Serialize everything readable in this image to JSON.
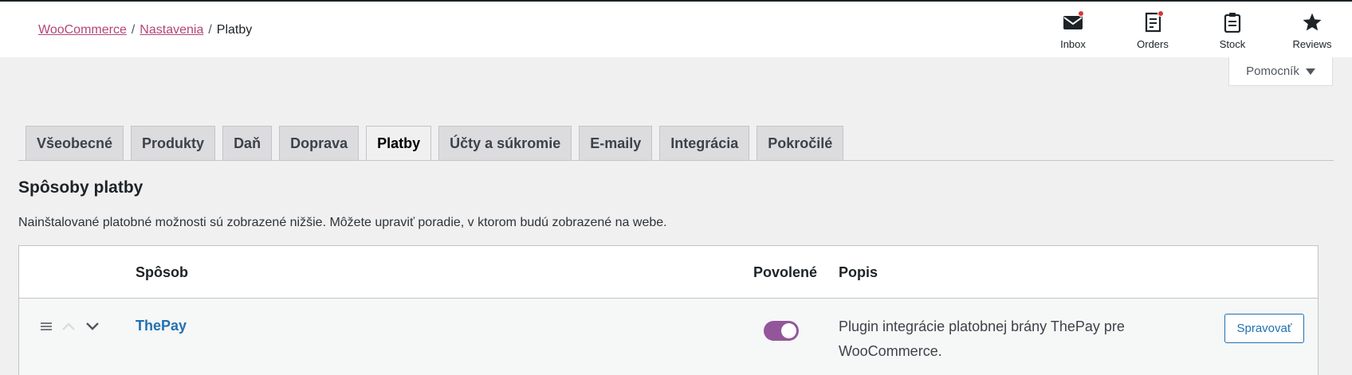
{
  "breadcrumb": {
    "items": [
      {
        "label": "WooCommerce",
        "link": true
      },
      {
        "label": "Nastavenia",
        "link": true
      },
      {
        "label": "Platby",
        "link": false
      }
    ],
    "separator": "/"
  },
  "activity_bar": [
    {
      "label": "Inbox",
      "icon": "inbox-icon",
      "has_dot": true
    },
    {
      "label": "Orders",
      "icon": "orders-icon",
      "has_dot": true
    },
    {
      "label": "Stock",
      "icon": "stock-icon",
      "has_dot": false
    },
    {
      "label": "Reviews",
      "icon": "star-icon",
      "has_dot": false
    }
  ],
  "help_button": {
    "label": "Pomocník"
  },
  "tabs": [
    {
      "label": "Všeobecné",
      "active": false
    },
    {
      "label": "Produkty",
      "active": false
    },
    {
      "label": "Daň",
      "active": false
    },
    {
      "label": "Doprava",
      "active": false
    },
    {
      "label": "Platby",
      "active": true
    },
    {
      "label": "Účty a súkromie",
      "active": false
    },
    {
      "label": "E-maily",
      "active": false
    },
    {
      "label": "Integrácia",
      "active": false
    },
    {
      "label": "Pokročilé",
      "active": false
    }
  ],
  "section": {
    "title": "Spôsoby platby",
    "description": "Nainštalované platobné možnosti sú zobrazené nižšie. Môžete upraviť poradie, v ktorom budú zobrazené na webe."
  },
  "table": {
    "headers": {
      "method": "Spôsob",
      "enabled": "Povolené",
      "description": "Popis"
    },
    "rows": [
      {
        "name": "ThePay",
        "enabled": true,
        "description": "Plugin integrácie platobnej brány ThePay pre WooCommerce.",
        "action_label": "Spravovať"
      }
    ]
  },
  "colors": {
    "link": "#b3467a",
    "primary": "#2271b1",
    "toggle_on": "#93569a",
    "notification_dot": "#d63638"
  }
}
